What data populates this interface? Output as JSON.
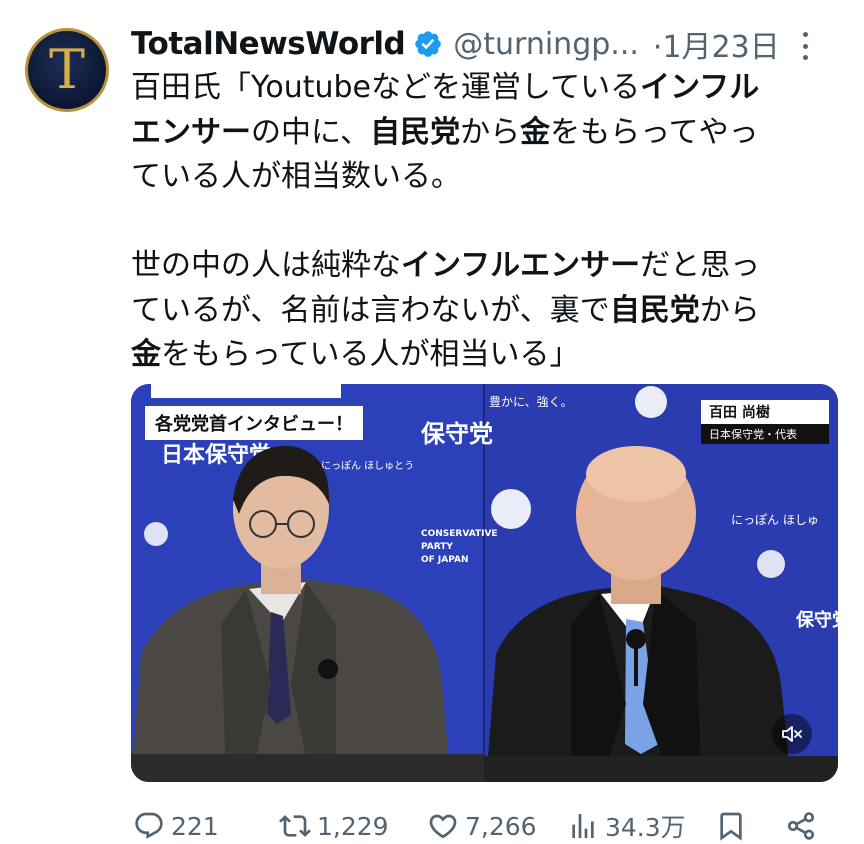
{
  "author": {
    "name": "TotalNewsWorld",
    "handle": "@turningp...",
    "separator": "·",
    "date": "1月23日",
    "avatar_letter": "T",
    "verified_color": "#1d9bf0"
  },
  "tweet_text": {
    "p1": [
      "百田氏「Youtubeなどを運営している",
      "インフル"
    ],
    "p2": [
      "エンサー",
      "の中に、",
      "自民党",
      "から",
      "金",
      "をもらってやっ"
    ],
    "p3": "ている人が相当数いる。",
    "p4": [
      "世の中の人は純粋な",
      "インフルエンサー",
      "だと思っ"
    ],
    "p5": [
      "ているが、名前は言わないが、裏で",
      "自民党",
      "から"
    ],
    "p6": [
      "金",
      "をもらっている人が相当いる」"
    ]
  },
  "media": {
    "caption": "各党党首インタビュー！",
    "nameplate_name": "百田 尚樹",
    "nameplate_role": "日本保守党・代表",
    "backdrop_text": {
      "left_top": "日本保守党",
      "left_small": "にっぽん ほしゅとう",
      "conservative": "CONSERVATIVE",
      "party": "PARTY",
      "of_japan": "OF JAPAN",
      "slogan": "豊かに、強く。",
      "right_small": "にっぽん ほしゅ",
      "hoshuto": "保守党"
    },
    "mute_icon": "speaker-muted-icon"
  },
  "actions": {
    "reply": "221",
    "retweet": "1,229",
    "like": "7,266",
    "views": "34.3万"
  },
  "colors": {
    "text": "#0f1419",
    "secondary": "#536471",
    "backdrop_blue": "#2a3fb5"
  }
}
